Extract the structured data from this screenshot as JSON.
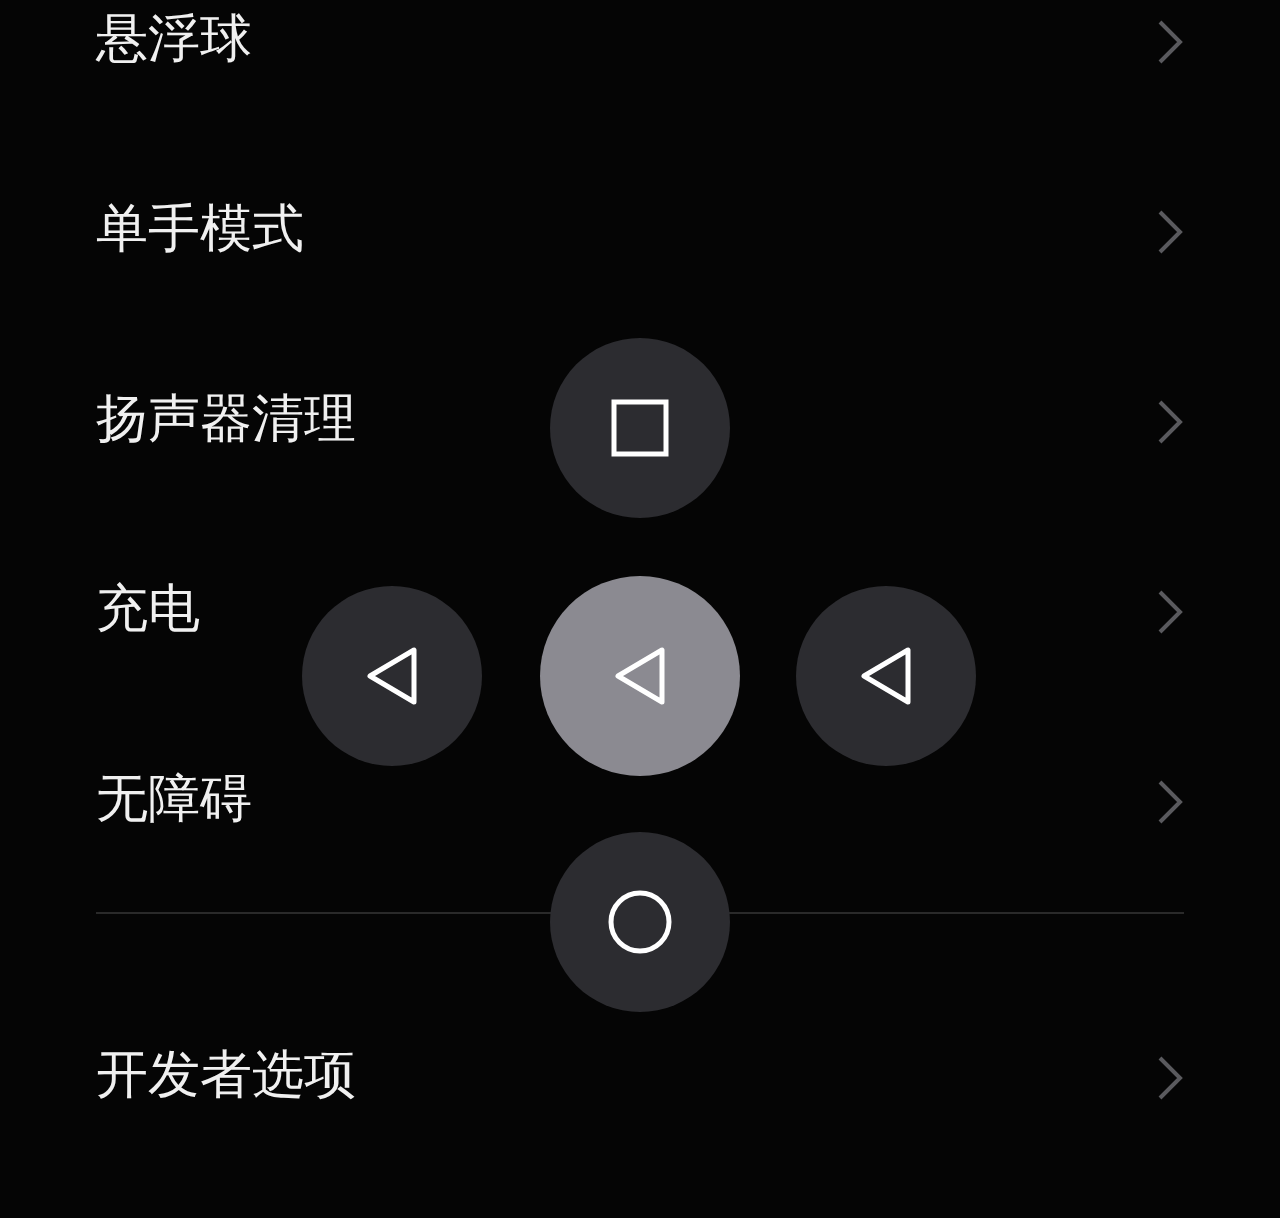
{
  "groups": [
    {
      "items": [
        {
          "label": "悬浮球"
        },
        {
          "label": "单手模式"
        },
        {
          "label": "扬声器清理"
        },
        {
          "label": "充电"
        },
        {
          "label": "无障碍"
        }
      ]
    },
    {
      "items": [
        {
          "label": "开发者选项"
        }
      ]
    }
  ],
  "float_ball": {
    "buttons": [
      {
        "kind": "square",
        "selected": false
      },
      {
        "kind": "back",
        "selected": false
      },
      {
        "kind": "back",
        "selected": true
      },
      {
        "kind": "back",
        "selected": false
      },
      {
        "kind": "circle",
        "selected": false
      }
    ]
  }
}
